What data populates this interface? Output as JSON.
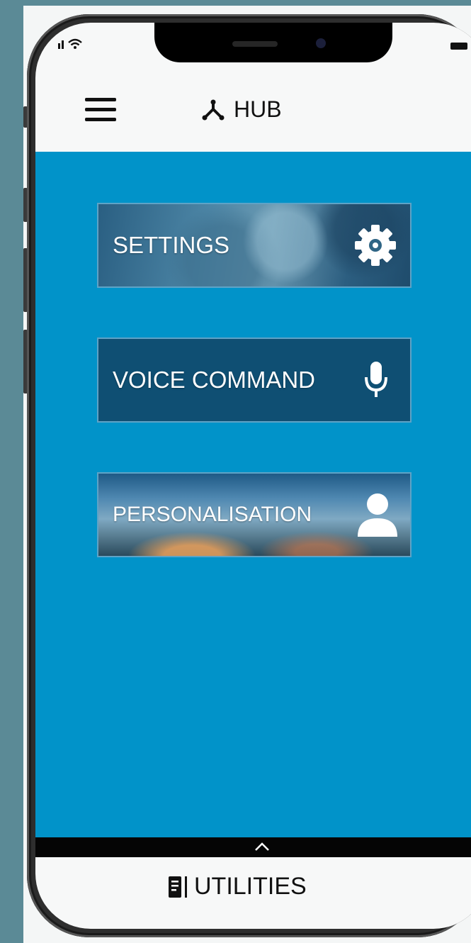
{
  "header": {
    "title": "HUB",
    "menu_icon": "hamburger-menu-icon",
    "title_icon": "hub-icon"
  },
  "cards": [
    {
      "label": "SETTINGS",
      "icon": "gear-icon"
    },
    {
      "label": "VOICE COMMAND",
      "icon": "microphone-icon"
    },
    {
      "label": "PERSONALISATION",
      "icon": "user-icon"
    }
  ],
  "footer": {
    "expand_icon": "chevron-up-icon",
    "label": "UTILITIES",
    "icon": "document-icon"
  },
  "colors": {
    "primary": "#0193c9",
    "header_bg": "#f7f8f8",
    "voice_card_bg": "#0f4f73",
    "outer_bg": "#5b8a96"
  }
}
